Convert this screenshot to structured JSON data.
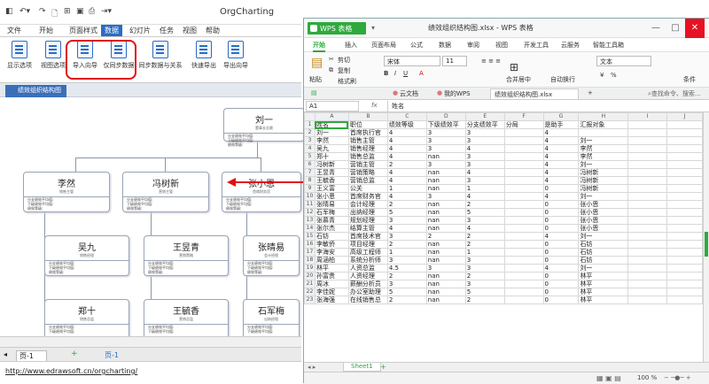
{
  "orgcharting": {
    "title": "OrgCharting",
    "menu": [
      "文件",
      "开始",
      "页面样式",
      "数据",
      "幻灯片",
      "任务",
      "视图",
      "帮助"
    ],
    "ribbon_buttons": [
      "显示选项",
      "视图选项",
      "导入向导",
      "仅同步数据",
      "同步数据与关系",
      "快速导出",
      "导出向导"
    ],
    "doc_tab": "绩效组织结构图",
    "nodes": [
      {
        "name": "刘一",
        "position": "董事长总裁",
        "fields": [
          "分支绩效平均值:",
          "下级绩效平均值:",
          "绩效等级:"
        ]
      },
      {
        "name": "李然",
        "position": "销售主管",
        "fields": [
          "分支绩效平均值:",
          "下级绩效平均值:",
          "绩效等级:"
        ]
      },
      {
        "name": "冯树新",
        "position": "营销主管",
        "fields": [
          "分支绩效平均值:",
          "下级绩效平均值:",
          "绩效等级:"
        ]
      },
      {
        "name": "张小恩",
        "position": "首席财务官",
        "fields": [
          "分支绩效平均值:",
          "下级绩效平均值:",
          "绩效等级:"
        ]
      },
      {
        "name": "吴九",
        "position": "销售经理",
        "fields": [
          "分支绩效平均值:",
          "下级绩效平均值:",
          "绩效等级:"
        ]
      },
      {
        "name": "王昱青",
        "position": "营销策略",
        "fields": [
          "分支绩效平均值:",
          "下级绩效平均值:",
          "绩效等级:"
        ]
      },
      {
        "name": "张晴易",
        "position": "会计经理",
        "fields": [
          "分支绩效平均值:",
          "下级绩效平均值:",
          "绩效等级:"
        ]
      },
      {
        "name": "郑十",
        "position": "销售总监",
        "fields": [
          "分支绩效平均值:",
          "下级绩效平均值:",
          "绩效等级:"
        ]
      },
      {
        "name": "王毓香",
        "position": "营销总监",
        "fields": [
          "分支绩效平均值:",
          "下级绩效平均值:",
          "绩效等级:"
        ]
      },
      {
        "name": "石军梅",
        "position": "出纳经理",
        "fields": [
          "分支绩效平均值:",
          "下级绩效平均值:",
          "绩效等级:"
        ]
      }
    ],
    "page_tab": "页-1",
    "page_add": "+",
    "status_url": "http://www.edrawsoft.cn/orgcharting/"
  },
  "wps": {
    "app_name": "WPS 表格",
    "doc_title": "绩效组织结构图.xlsx - WPS 表格",
    "window_controls": [
      "—",
      "□",
      "✕"
    ],
    "menu": [
      "开始",
      "插入",
      "页面布局",
      "公式",
      "数据",
      "审阅",
      "视图",
      "开发工具",
      "云服务",
      "智能工具箱"
    ],
    "ribbon": {
      "paste": "粘贴",
      "cut": "剪切",
      "copy": "复制",
      "format_painter": "格式刷",
      "font_name": "宋体",
      "font_size": "11",
      "merge": "合并居中",
      "wrap": "自动换行",
      "number_format": "文本",
      "percent": "%",
      "condition": "条件"
    },
    "tabs": [
      "云文档",
      "我的WPS",
      "绩效组织结构图.xlsx"
    ],
    "search_placeholder": "查找命令、搜索...",
    "name_box": "A1",
    "fx": "fx",
    "formula_value": "姓名",
    "col_letters": [
      "",
      "A",
      "B",
      "C",
      "D",
      "E",
      "F",
      "G",
      "H",
      "I",
      "J"
    ],
    "rows": [
      [
        "姓名",
        "职位",
        "绩效等级",
        "下级绩效平",
        "分支绩效平",
        "分局",
        "是助手",
        "汇报对象"
      ],
      [
        "刘一",
        "首席执行官",
        "4",
        "3",
        "3",
        "",
        "4",
        ""
      ],
      [
        "李然",
        "销售主管",
        "4",
        "3",
        "3",
        "",
        "4",
        "刘一"
      ],
      [
        "吴九",
        "销售经理",
        "4",
        "3",
        "4",
        "",
        "4",
        "李然"
      ],
      [
        "郑十",
        "销售总监",
        "4",
        "nan",
        "3",
        "",
        "4",
        "李然"
      ],
      [
        "冯树新",
        "营销主管",
        "2",
        "3",
        "3",
        "",
        "4",
        "刘一"
      ],
      [
        "王昱青",
        "营销策略",
        "4",
        "nan",
        "4",
        "",
        "4",
        "冯树新"
      ],
      [
        "王毓香",
        "营销总监",
        "4",
        "nan",
        "3",
        "",
        "4",
        "冯树新"
      ],
      [
        "王义富",
        "公关",
        "1",
        "nan",
        "1",
        "",
        "0",
        "冯树新"
      ],
      [
        "张小恩",
        "首席财务官",
        "4",
        "3",
        "4",
        "",
        "4",
        "刘一"
      ],
      [
        "张晴易",
        "会计经理",
        "2",
        "nan",
        "2",
        "",
        "0",
        "张小恩"
      ],
      [
        "石军梅",
        "出纳经理",
        "5",
        "nan",
        "5",
        "",
        "0",
        "张小恩"
      ],
      [
        "张慕青",
        "规划经理",
        "3",
        "nan",
        "3",
        "",
        "0",
        "张小恩"
      ],
      [
        "张尔杰",
        "结算主管",
        "4",
        "nan",
        "4",
        "",
        "0",
        "张小恩"
      ],
      [
        "石钫",
        "首席技术官",
        "3",
        "2",
        "2",
        "",
        "4",
        "刘一"
      ],
      [
        "李敏侨",
        "项目经理",
        "2",
        "nan",
        "2",
        "",
        "0",
        "石钫"
      ],
      [
        "李海安",
        "高级工程师",
        "1",
        "nan",
        "1",
        "",
        "0",
        "石钫"
      ],
      [
        "周涵柏",
        "系统分析师",
        "3",
        "nan",
        "3",
        "",
        "0",
        "石钫"
      ],
      [
        "林平",
        "人资总监",
        "4.5",
        "3",
        "3",
        "",
        "4",
        "刘一"
      ],
      [
        "孙富贵",
        "人资经理",
        "2",
        "nan",
        "2",
        "",
        "0",
        "林平"
      ],
      [
        "周冰",
        "薪酬分析员",
        "3",
        "nan",
        "3",
        "",
        "0",
        "林平"
      ],
      [
        "李佳妮",
        "办公室助理",
        "5",
        "nan",
        "5",
        "",
        "0",
        "林平"
      ],
      [
        "张海强",
        "在线销售总",
        "2",
        "nan",
        "2",
        "",
        "0",
        "林平"
      ]
    ],
    "sheet_name": "Sheet1",
    "zoom": "100 %"
  }
}
